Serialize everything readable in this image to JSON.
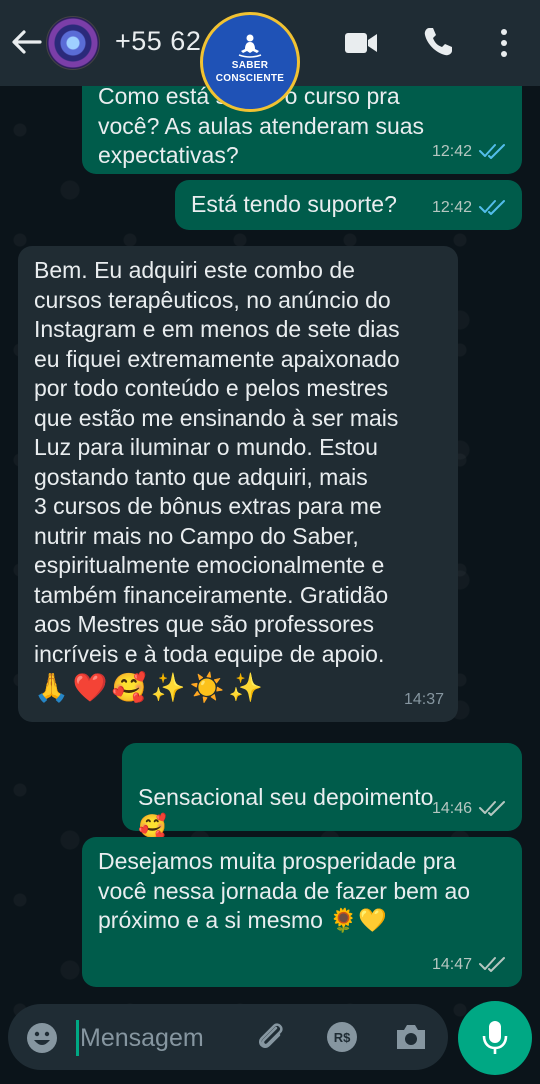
{
  "header": {
    "contact_name": "+55 62 ...",
    "badge_line1": "SABER",
    "badge_line2": "CONSCIENTE"
  },
  "messages": [
    {
      "direction": "out",
      "text": "Como está sendo o curso pra\nvocê? As aulas atenderam suas\nexpectativas?",
      "time": "12:42",
      "status": "read"
    },
    {
      "direction": "out",
      "text": "Está tendo suporte?",
      "time": "12:42",
      "status": "read"
    },
    {
      "direction": "in",
      "text": "Bem. Eu adquiri este combo de\ncursos terapêuticos, no anúncio do\nInstagram e em menos de sete dias\neu fiquei extremamente apaixonado\npor todo conteúdo e pelos mestres\nque estão me ensinando à ser mais\nLuz para iluminar o mundo. Estou\ngostando tanto que adquiri, mais\n3 cursos de bônus extras para me\nnutrir mais no Campo do Saber,\nespiritualmente emocionalmente e\ntambém financeiramente. Gratidão\naos Mestres que são professores\nincríveis e à toda equipe de apoio.",
      "emojis": [
        "🙏",
        "❤️",
        "🥰",
        "✨",
        "☀️",
        "✨"
      ],
      "time": "14:37"
    },
    {
      "direction": "out",
      "text": "Sensacional seu depoimento",
      "emoji": "🥰",
      "time": "14:46",
      "status": "delivered"
    },
    {
      "direction": "out",
      "text": "Desejamos muita prosperidade pra\nvocê nessa jornada de fazer bem ao\npróximo e a si mesmo",
      "emojis": [
        "🌻",
        "💛"
      ],
      "time": "14:47",
      "status": "delivered"
    }
  ],
  "input": {
    "placeholder": "Mensagem"
  },
  "colors": {
    "header_bg": "#1f2c34",
    "chat_bg": "#0b141a",
    "outgoing_bubble": "#005c4b",
    "incoming_bubble": "#202c33",
    "accent": "#00a884",
    "read_tick": "#53bdeb",
    "badge_bg": "#1f52b6",
    "badge_border": "#f1c232"
  },
  "icons": [
    "back-arrow-icon",
    "avatar",
    "video-call-icon",
    "voice-call-icon",
    "more-options-icon",
    "emoji-icon",
    "attach-icon",
    "payment-icon",
    "camera-icon",
    "mic-icon"
  ]
}
